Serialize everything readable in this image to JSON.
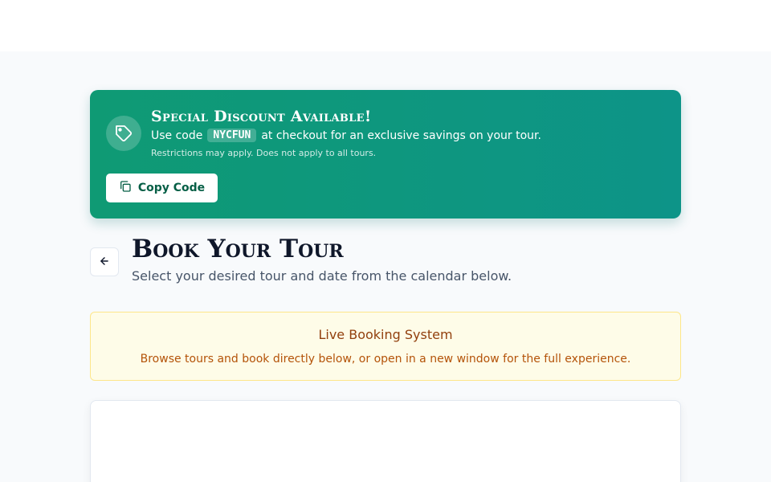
{
  "promo": {
    "title": "Special Discount Available!",
    "line_prefix": "Use code",
    "code": "NYCFUN",
    "line_suffix": "at checkout for an exclusive savings on your tour.",
    "note": "Restrictions may apply. Does not apply to all tours.",
    "copy_label": "Copy Code",
    "icon": "tag-icon"
  },
  "header": {
    "back_icon": "arrow-left-icon",
    "title": "Book Your Tour",
    "subtitle": "Select your desired tour and date from the calendar below."
  },
  "notice": {
    "title": "Live Booking System",
    "text": "Browse tours and book directly below, or open in a new window for the full experience."
  },
  "colors": {
    "promo_green": "#0f9a74",
    "promo_teal": "#0d9488",
    "notice_bg": "#fefce8",
    "notice_text": "#b45309"
  }
}
